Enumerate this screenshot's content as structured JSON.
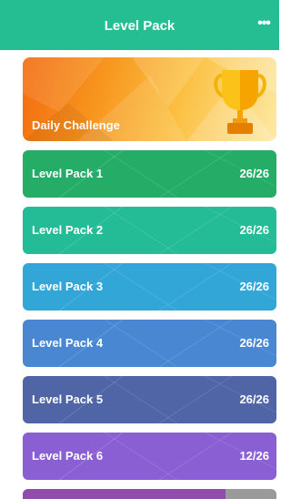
{
  "header": {
    "title": "Level Pack",
    "more_icon": "ellipsis-icon",
    "color": "#25be93"
  },
  "daily_challenge": {
    "label": "Daily Challenge",
    "icon": "trophy-icon"
  },
  "packs": [
    {
      "name": "Level Pack 1",
      "count": "26/26",
      "color": "#25ad68"
    },
    {
      "name": "Level Pack 2",
      "count": "26/26",
      "color": "#23bc97"
    },
    {
      "name": "Level Pack 3",
      "count": "26/26",
      "color": "#33a6d8"
    },
    {
      "name": "Level Pack 4",
      "count": "26/26",
      "color": "#4a87d3"
    },
    {
      "name": "Level Pack 5",
      "count": "26/26",
      "color": "#4f65a6"
    },
    {
      "name": "Level Pack 6",
      "count": "12/26",
      "color": "#8a5fd4"
    }
  ],
  "partial_pack": {
    "color": "#8d4fab",
    "empty_color": "#9a9a9a",
    "progress": 0.8
  }
}
